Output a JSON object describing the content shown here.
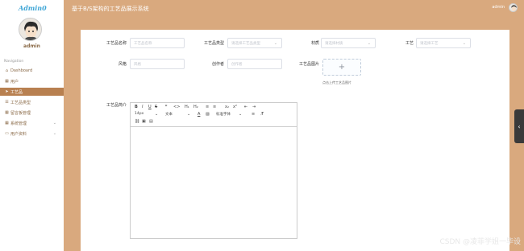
{
  "app": {
    "logo": "Admin0",
    "title": "基于B/S架构的工艺品展示系统",
    "user_header": "admin"
  },
  "sidebar": {
    "username": "admin",
    "caption": "Navigation",
    "items": [
      {
        "label": "Dashboard",
        "icon": "home-icon"
      },
      {
        "label": "用户",
        "icon": "grid-icon"
      },
      {
        "label": "工艺品",
        "icon": "send-icon",
        "active": true
      },
      {
        "label": "工艺品类型",
        "icon": "list-icon"
      },
      {
        "label": "留言板管理",
        "icon": "grid-icon"
      },
      {
        "label": "系统管理",
        "icon": "grid-icon",
        "expandable": true
      },
      {
        "label": "用户资料",
        "icon": "calendar-icon",
        "expandable": true
      }
    ]
  },
  "form": {
    "name": {
      "label": "工艺品名称",
      "placeholder": "工艺品名称"
    },
    "type": {
      "label": "工艺品类型",
      "placeholder": "请选择工艺品类型"
    },
    "material": {
      "label": "材质",
      "placeholder": "请选择材质"
    },
    "craft": {
      "label": "工艺",
      "placeholder": "请选择工艺"
    },
    "style": {
      "label": "风格",
      "placeholder": "风格"
    },
    "author": {
      "label": "创作者",
      "placeholder": "创作者"
    },
    "image": {
      "label": "工艺品图片",
      "tip": "点击上传工艺品图片"
    },
    "intro": {
      "label": "工艺品简介"
    }
  },
  "editor": {
    "row1": [
      "B",
      "I",
      "U",
      "S",
      "❞",
      "<>",
      "H₁",
      "H₂",
      "≡",
      "≡",
      "x₂",
      "x²",
      "⇤",
      "⇥"
    ],
    "font_size": "14px",
    "text_style": "文本",
    "font_family": "标准字体",
    "row3_icons": [
      "link-icon",
      "image-icon",
      "video-icon"
    ]
  },
  "watermark": "CSDN @凌菲学姐一毕设"
}
